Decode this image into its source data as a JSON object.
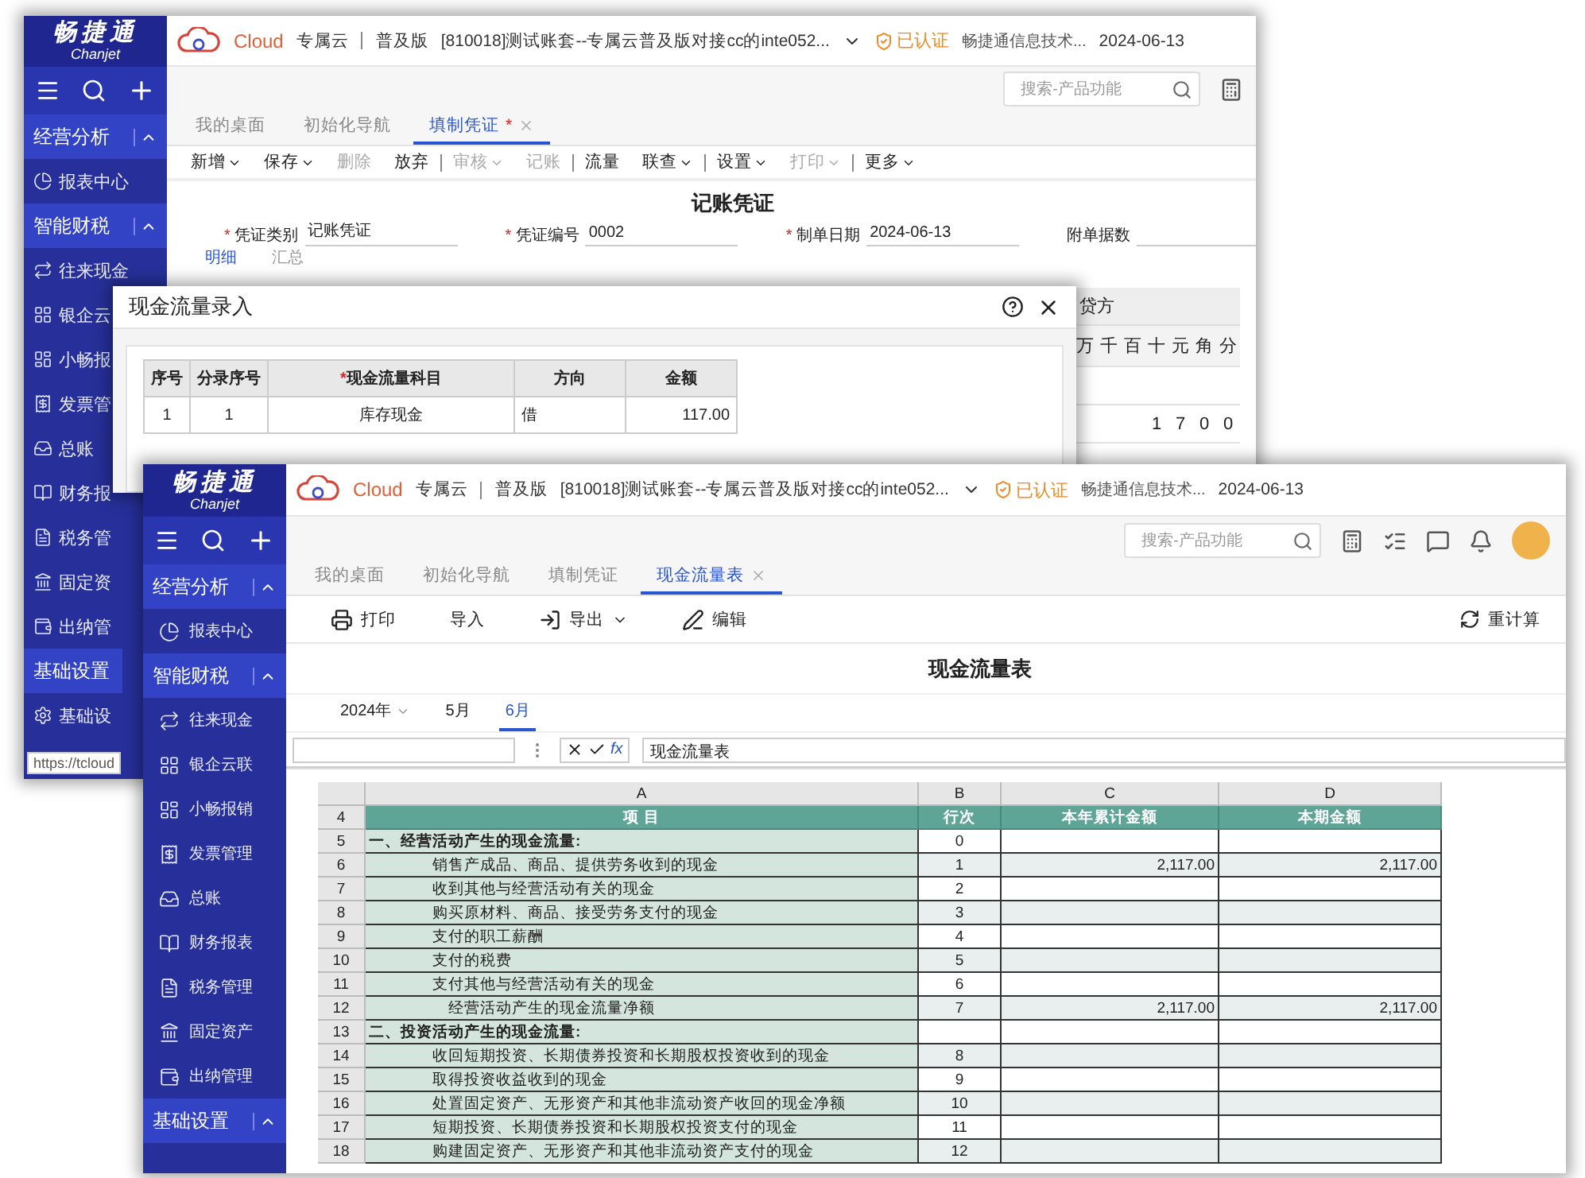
{
  "back_window": {
    "sidebar": {
      "logo": "畅捷通",
      "logo_latin": "Chanjet",
      "items": [
        {
          "kind": "header",
          "label": "经营分析",
          "expanded": true
        },
        {
          "kind": "link",
          "label": "报表中心"
        },
        {
          "kind": "header",
          "label": "智能财税",
          "expanded": true
        },
        {
          "kind": "link",
          "label": "往来现金"
        },
        {
          "kind": "link",
          "label": "银企云"
        },
        {
          "kind": "link",
          "label": "小畅报"
        },
        {
          "kind": "link",
          "label": "发票管"
        },
        {
          "kind": "link",
          "label": "总账"
        },
        {
          "kind": "link",
          "label": "财务报"
        },
        {
          "kind": "link",
          "label": "税务管"
        },
        {
          "kind": "link",
          "label": "固定资"
        },
        {
          "kind": "link",
          "label": "出纳管"
        },
        {
          "kind": "header",
          "label": "基础设置"
        },
        {
          "kind": "link",
          "label": "基础设"
        }
      ]
    },
    "status_url": "https://tcloud",
    "topbar": {
      "brand": "Cloud",
      "cloud_label": "专属云",
      "edition": "普及版",
      "account": "[810018]测试账套--专属云普及版对接cc的inte052...",
      "cert": "已认证",
      "company": "畅捷通信息技术...",
      "date": "2024-06-13"
    },
    "search": {
      "placeholder": "搜索-产品功能"
    },
    "tabs": [
      {
        "label": "我的桌面",
        "selected": false
      },
      {
        "label": "初始化导航",
        "selected": false
      },
      {
        "label": "填制凭证",
        "selected": true,
        "modified_mark": "*"
      }
    ],
    "toolbar": [
      {
        "label": "新增",
        "dropdown": true,
        "disabled": false
      },
      {
        "label": "保存",
        "dropdown": true,
        "disabled": false
      },
      {
        "label": "删除",
        "dropdown": false,
        "disabled": true
      },
      {
        "label": "放弃",
        "dropdown": false,
        "disabled": false
      },
      {
        "label": "审核",
        "dropdown": true,
        "disabled": true
      },
      {
        "label": "记账",
        "dropdown": false,
        "disabled": true
      },
      {
        "label": "流量",
        "dropdown": false,
        "disabled": false
      },
      {
        "label": "联查",
        "dropdown": true,
        "disabled": false
      },
      {
        "label": "设置",
        "dropdown": true,
        "disabled": false
      },
      {
        "label": "打印",
        "dropdown": true,
        "disabled": true
      },
      {
        "label": "更多",
        "dropdown": true,
        "disabled": false
      }
    ],
    "voucher": {
      "title": "记账凭证",
      "fields": [
        {
          "label": "凭证类别",
          "required_mark": "*",
          "value": "记账凭证"
        },
        {
          "label": "凭证编号",
          "required_mark": "*",
          "value": "0002"
        },
        {
          "label": "制单日期",
          "required_mark": "*",
          "value": "2024-06-13"
        },
        {
          "label": "附单据数"
        }
      ],
      "subtabs": [
        {
          "label": "明细",
          "selected": true
        },
        {
          "label": "汇总",
          "selected": false
        }
      ]
    },
    "grid": {
      "column": "贷方",
      "digits": [
        "万",
        "千",
        "百",
        "十",
        "元",
        "角",
        "分"
      ],
      "row": [
        "1",
        "7",
        "0",
        "0"
      ]
    }
  },
  "dialog": {
    "title": "现金流量录入",
    "columns": [
      {
        "label": "序号"
      },
      {
        "label": "分录序号"
      },
      {
        "label": "现金流量科目",
        "required_mark": "*"
      },
      {
        "label": "方向"
      },
      {
        "label": "金额"
      }
    ],
    "rows": [
      [
        "1",
        "1",
        "库存现金",
        "借",
        "117.00"
      ]
    ]
  },
  "front_window": {
    "sidebar": {
      "logo": "畅捷通",
      "logo_latin": "Chanjet",
      "items": [
        {
          "kind": "header",
          "label": "经营分析",
          "expanded": true
        },
        {
          "kind": "link",
          "label": "报表中心"
        },
        {
          "kind": "header",
          "label": "智能财税",
          "expanded": true
        },
        {
          "kind": "link",
          "label": "往来现金"
        },
        {
          "kind": "link",
          "label": "银企云联"
        },
        {
          "kind": "link",
          "label": "小畅报销"
        },
        {
          "kind": "link",
          "label": "发票管理"
        },
        {
          "kind": "link",
          "label": "总账"
        },
        {
          "kind": "link",
          "label": "财务报表"
        },
        {
          "kind": "link",
          "label": "税务管理"
        },
        {
          "kind": "link",
          "label": "固定资产"
        },
        {
          "kind": "link",
          "label": "出纳管理"
        },
        {
          "kind": "header",
          "label": "基础设置",
          "expanded": true
        }
      ]
    },
    "topbar": {
      "brand": "Cloud",
      "cloud_label": "专属云",
      "edition": "普及版",
      "account": "[810018]测试账套--专属云普及版对接cc的inte052...",
      "cert": "已认证",
      "company": "畅捷通信息技术...",
      "date": "2024-06-13"
    },
    "search": {
      "placeholder": "搜索-产品功能"
    },
    "tabs": [
      {
        "label": "我的桌面",
        "selected": false
      },
      {
        "label": "初始化导航",
        "selected": false
      },
      {
        "label": "填制凭证",
        "selected": false
      },
      {
        "label": "现金流量表",
        "selected": true
      }
    ],
    "toolbar": [
      {
        "kind": "print",
        "label": "打印"
      },
      {
        "kind": "import",
        "label": "导入"
      },
      {
        "kind": "export",
        "label": "导出"
      },
      {
        "kind": "edit",
        "label": "编辑"
      }
    ],
    "recalc": "重计算",
    "report_title": "现金流量表",
    "periods": [
      {
        "label": "2024年",
        "dropdown": true,
        "selected": false
      },
      {
        "label": "5月",
        "dropdown": false,
        "selected": false
      },
      {
        "label": "6月",
        "dropdown": false,
        "selected": true
      }
    ],
    "formula_bar": {
      "formula_button": "fx",
      "value": "现金流量表"
    },
    "sheet": {
      "columns": [
        "A",
        "B",
        "C",
        "D"
      ],
      "header": {
        "row": "4",
        "cells": [
          "项  目",
          "行次",
          "本年累计金额",
          "本期金额"
        ]
      },
      "rows": [
        {
          "row": "5",
          "kind": "section",
          "item": "一、经营活动产生的现金流量:",
          "line": "0"
        },
        {
          "row": "6",
          "kind": "item",
          "item": "销售产成品、商品、提供劳务收到的现金",
          "line": "1",
          "ytd": "2,117.00",
          "period": "2,117.00"
        },
        {
          "row": "7",
          "kind": "item",
          "item": "收到其他与经营活动有关的现金",
          "line": "2"
        },
        {
          "row": "8",
          "kind": "item",
          "item": "购买原材料、商品、接受劳务支付的现金",
          "line": "3"
        },
        {
          "row": "9",
          "kind": "item",
          "item": "支付的职工薪酬",
          "line": "4"
        },
        {
          "row": "10",
          "kind": "item",
          "item": "支付的税费",
          "line": "5"
        },
        {
          "row": "11",
          "kind": "item",
          "item": "支付其他与经营活动有关的现金",
          "line": "6"
        },
        {
          "row": "12",
          "kind": "subtotal",
          "item": "经营活动产生的现金流量净额",
          "line": "7",
          "ytd": "2,117.00",
          "period": "2,117.00"
        },
        {
          "row": "13",
          "kind": "section",
          "item": "二、投资活动产生的现金流量:"
        },
        {
          "row": "14",
          "kind": "item",
          "item": "收回短期投资、长期债券投资和长期股权投资收到的现金",
          "line": "8"
        },
        {
          "row": "15",
          "kind": "item",
          "item": "取得投资收益收到的现金",
          "line": "9"
        },
        {
          "row": "16",
          "kind": "item",
          "item": "处置固定资产、无形资产和其他非流动资产收回的现金净额",
          "line": "10"
        },
        {
          "row": "17",
          "kind": "item",
          "item": "短期投资、长期债券投资和长期股权投资支付的现金",
          "line": "11"
        },
        {
          "row": "18",
          "kind": "item",
          "item": "购建固定资产、无形资产和其他非流动资产支付的现金",
          "line": "12"
        }
      ]
    }
  }
}
